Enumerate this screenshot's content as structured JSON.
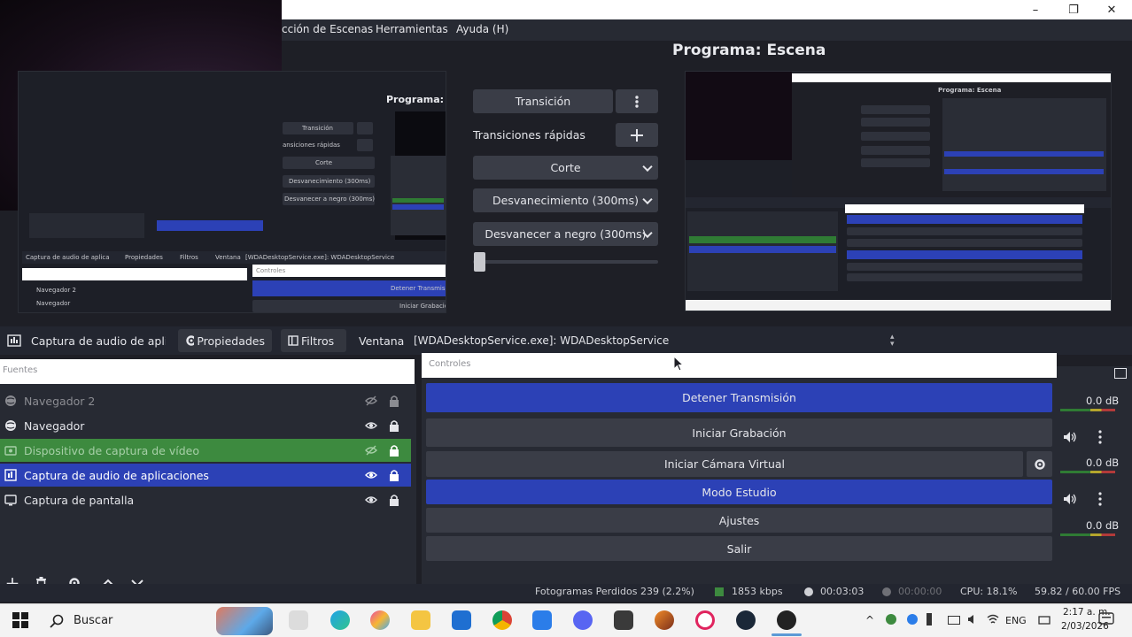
{
  "window": {
    "minimize": "–",
    "maximize": "❐",
    "close": "✕"
  },
  "menu": {
    "items": [
      "cción de Escenas",
      "Herramientas",
      "Ayuda (H)"
    ]
  },
  "program": {
    "title": "Programa: Escena"
  },
  "preview_small": {
    "title": "Programa: Esc",
    "transition": "Transición",
    "rapid": "ansiciones rápidas",
    "cut": "Corte",
    "fade": "Desvanecimiento (300ms)",
    "fade_black": "Desvanecer a negro (300ms)",
    "src_label": "Captura de audio de aplica",
    "props": "Propiedades",
    "filters": "Filtros",
    "window": "Ventana",
    "window_val": "[WDADesktopService.exe]: WDADesktopService",
    "sources_ph": "Fuentes",
    "nav2": "Navegador 2",
    "nav": "Navegador",
    "stop": "Detener Transmisi",
    "record": "Iniciar Grabación",
    "controls": "Controles"
  },
  "transitions": {
    "transition_label": "Transición",
    "menu_icon": "vertical-dots-icon",
    "rapid_label": "Transiciones rápidas",
    "add_icon": "plus-icon",
    "cut_option": "Corte",
    "fade_option": "Desvanecimiento (300ms)",
    "fade_black_option": "Desvanecer a negro (300ms)",
    "slider_value": 0
  },
  "source_toolbar": {
    "source_name": "Captura de audio de aplicac",
    "properties": "Propiedades",
    "filters": "Filtros",
    "window_label": "Ventana",
    "window_value": "[WDADesktopService.exe]: WDADesktopService"
  },
  "sources": {
    "header": "Fuentes",
    "items": [
      {
        "label": "Navegador 2",
        "visible": false,
        "locked": true,
        "state": "dim"
      },
      {
        "label": "Navegador",
        "visible": true,
        "locked": true,
        "state": "normal"
      },
      {
        "label": "Dispositivo de captura de vídeo",
        "visible": false,
        "locked": true,
        "state": "green"
      },
      {
        "label": "Captura de audio de aplicaciones",
        "visible": true,
        "locked": true,
        "state": "selected"
      },
      {
        "label": "Captura de pantalla",
        "visible": true,
        "locked": true,
        "state": "normal"
      }
    ],
    "footer": {
      "add": "+",
      "remove": "trash-icon",
      "settings": "gear-icon",
      "up": "chevron-up-icon",
      "down": "chevron-down-icon"
    }
  },
  "controls": {
    "header": "Controles",
    "stop_streaming": "Detener Transmisión",
    "start_recording": "Iniciar Grabación",
    "start_virtual_cam": "Iniciar Cámara Virtual",
    "studio_mode": "Modo Estudio",
    "settings": "Ajustes",
    "exit": "Salir"
  },
  "mixer": {
    "levels": [
      "0.0 dB",
      "0.0 dB",
      "0.0 dB"
    ]
  },
  "status": {
    "dropped_frames": "Fotogramas Perdidos 239 (2.2%)",
    "bitrate": "1853 kbps",
    "stream_time": "00:03:03",
    "rec_time": "00:00:00",
    "cpu": "CPU: 18.1%",
    "fps": "59.82 / 60.00 FPS"
  },
  "taskbar": {
    "search_placeholder": "Buscar",
    "language": "ENG",
    "time": "2:17 a. m.",
    "date": "2/03/2026"
  },
  "colors": {
    "accent_blue": "#2c41b6",
    "green_row": "#3d8a3f",
    "panel": "#272a33"
  }
}
